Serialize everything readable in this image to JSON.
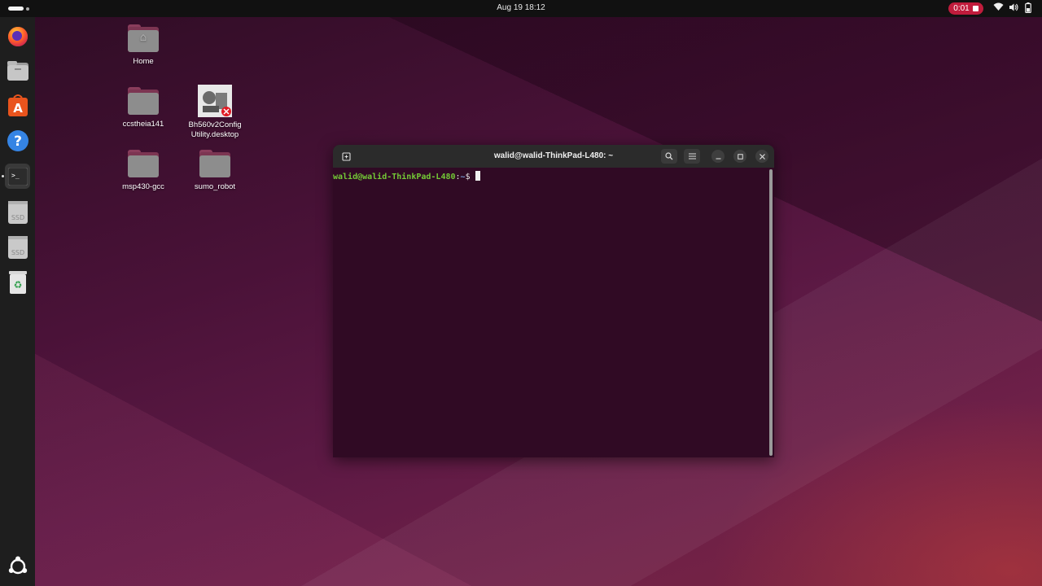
{
  "topbar": {
    "datetime": "Aug 19  18:12",
    "recording_time": "0:01"
  },
  "dock": {
    "items": [
      {
        "name": "Firefox",
        "icon": "firefox-icon"
      },
      {
        "name": "Files",
        "icon": "files-icon"
      },
      {
        "name": "App Center",
        "icon": "app-center-icon"
      },
      {
        "name": "Help",
        "icon": "help-icon"
      },
      {
        "name": "Terminal",
        "icon": "terminal-icon",
        "active": true
      },
      {
        "name": "SSD",
        "icon": "ssd-drive-icon"
      },
      {
        "name": "SSD",
        "icon": "ssd-drive-icon"
      },
      {
        "name": "Trash",
        "icon": "trash-icon"
      },
      {
        "name": "Show Apps",
        "icon": "ubuntu-apps-icon"
      }
    ],
    "drive_label": "SSD"
  },
  "desktop": {
    "icons": [
      {
        "label": "Home"
      },
      {
        "label": "ccstheia141"
      },
      {
        "label": "Bh560v2Config Utility.desktop"
      },
      {
        "label": "msp430-gcc"
      },
      {
        "label": "sumo_robot"
      }
    ]
  },
  "terminal": {
    "title": "walid@walid-ThinkPad-L480: ~",
    "prompt_user": "walid@walid-ThinkPad-L480",
    "prompt_sep": ":",
    "prompt_path": "~",
    "prompt_symbol": "$ "
  },
  "colors": {
    "terminal_bg": "#300a24",
    "prompt_user": "#73c936",
    "prompt_path": "#7a9fd6",
    "recording": "#c01c3c"
  }
}
